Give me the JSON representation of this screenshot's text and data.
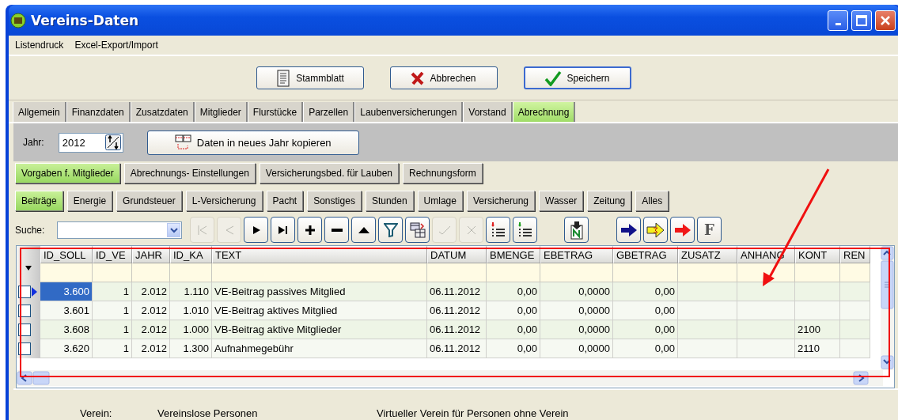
{
  "window": {
    "title": "Vereins-Daten"
  },
  "menu": [
    "Listendruck",
    "Excel-Export/Import"
  ],
  "actions": [
    {
      "kind": "sheet",
      "label": "Stammblatt",
      "focused": false
    },
    {
      "kind": "cancel",
      "label": "Abbrechen",
      "focused": false
    },
    {
      "kind": "save",
      "label": "Speichern",
      "focused": true
    }
  ],
  "tabs": [
    {
      "label": "Allgemein",
      "selected": false
    },
    {
      "label": "Finanzdaten",
      "selected": false
    },
    {
      "label": "Zusatzdaten",
      "selected": false
    },
    {
      "label": "Mitglieder",
      "selected": false
    },
    {
      "label": "Flurstücke",
      "selected": false
    },
    {
      "label": "Parzellen",
      "selected": false
    },
    {
      "label": "Laubenversicherungen",
      "selected": false
    },
    {
      "label": "Vorstand",
      "selected": false
    },
    {
      "label": "Abrechnung",
      "selected": true
    }
  ],
  "year": {
    "label": "Jahr:",
    "value": "2012"
  },
  "copy_button": {
    "label": "Daten in neues Jahr kopieren"
  },
  "subtabs": [
    {
      "label": "Vorgaben f. Mitglieder",
      "selected": true
    },
    {
      "label": "Abrechnungs- Einstellungen",
      "selected": false
    },
    {
      "label": "Versicherungsbed. für Lauben",
      "selected": false
    },
    {
      "label": "Rechnungsform",
      "selected": false
    }
  ],
  "categories": [
    {
      "label": "Beiträge",
      "selected": true
    },
    {
      "label": "Energie",
      "selected": false
    },
    {
      "label": "Grundsteuer",
      "selected": false
    },
    {
      "label": "L-Versicherung",
      "selected": false
    },
    {
      "label": "Pacht",
      "selected": false
    },
    {
      "label": "Sonstiges",
      "selected": false
    },
    {
      "label": "Stunden",
      "selected": false
    },
    {
      "label": "Umlage",
      "selected": false
    },
    {
      "label": "Versicherung",
      "selected": false
    },
    {
      "label": "Wasser",
      "selected": false
    },
    {
      "label": "Zeitung",
      "selected": false
    },
    {
      "label": "Alles",
      "selected": false
    }
  ],
  "search": {
    "label": "Suche:"
  },
  "toolbar_groups": [
    {
      "buttons": [
        {
          "kind": "first",
          "disabled": true
        },
        {
          "kind": "prev",
          "disabled": true
        },
        {
          "kind": "next",
          "disabled": false
        },
        {
          "kind": "last",
          "disabled": false
        },
        {
          "kind": "add",
          "disabled": false
        },
        {
          "kind": "remove",
          "disabled": false
        },
        {
          "kind": "up",
          "disabled": false
        },
        {
          "kind": "filter",
          "disabled": false
        },
        {
          "kind": "copy",
          "disabled": false
        },
        {
          "kind": "edit",
          "disabled": true
        },
        {
          "kind": "cancel",
          "disabled": true
        },
        {
          "kind": "list-red",
          "disabled": false
        },
        {
          "kind": "list-green",
          "disabled": false
        }
      ]
    },
    {
      "buttons": [
        {
          "kind": "doc",
          "disabled": false
        }
      ]
    },
    {
      "buttons": [
        {
          "kind": "arrow-blue",
          "disabled": false
        },
        {
          "kind": "arrow-yellow",
          "disabled": false
        },
        {
          "kind": "arrow-red",
          "disabled": false
        },
        {
          "kind": "letter",
          "label": "F",
          "disabled": false
        }
      ]
    }
  ],
  "table": {
    "columns": [
      {
        "label": "ID_SOLL",
        "numeric": true
      },
      {
        "label": "ID_VE",
        "numeric": true
      },
      {
        "label": "JAHR",
        "numeric": true
      },
      {
        "label": "ID_KA",
        "numeric": true
      },
      {
        "label": "TEXT",
        "numeric": false
      },
      {
        "label": "DATUM",
        "numeric": false
      },
      {
        "label": "BMENGE",
        "numeric": true
      },
      {
        "label": "EBETRAG",
        "numeric": true
      },
      {
        "label": "GBETRAG",
        "numeric": true
      },
      {
        "label": "ZUSATZ"
      },
      {
        "label": "ANHANG"
      },
      {
        "label": "KONT"
      },
      {
        "label": "REN"
      }
    ],
    "rows": [
      {
        "selected": true,
        "checked": false,
        "cells": [
          "3.600",
          "1",
          "2.012",
          "1.110",
          "VE-Beitrag passives Mitglied",
          "06.11.2012",
          "0,00",
          "0,0000",
          "0,00",
          null,
          null,
          null,
          null
        ]
      },
      {
        "selected": false,
        "checked": false,
        "cells": [
          "3.601",
          "1",
          "2.012",
          "1.010",
          "VE-Beitrag aktives Mitglied",
          "06.11.2012",
          "0,00",
          "0,0000",
          "0,00",
          null,
          null,
          null,
          null
        ]
      },
      {
        "selected": false,
        "checked": false,
        "cells": [
          "3.608",
          "1",
          "2.012",
          "1.000",
          "VB-Beitrag aktive Mitglieder",
          "06.11.2012",
          "0,00",
          "0,0000",
          "0,00",
          null,
          null,
          "2100",
          null
        ]
      },
      {
        "selected": false,
        "checked": false,
        "cells": [
          "3.620",
          "1",
          "2.012",
          "1.300",
          "Aufnahmegebühr",
          "06.11.2012",
          "0,00",
          "0,0000",
          "0,00",
          null,
          null,
          "2110",
          null
        ]
      }
    ]
  },
  "status_bar": {
    "label": "Verein:",
    "name": "Vereinslose Personen",
    "description": "Virtueller Verein für Personen ohne Verein"
  }
}
